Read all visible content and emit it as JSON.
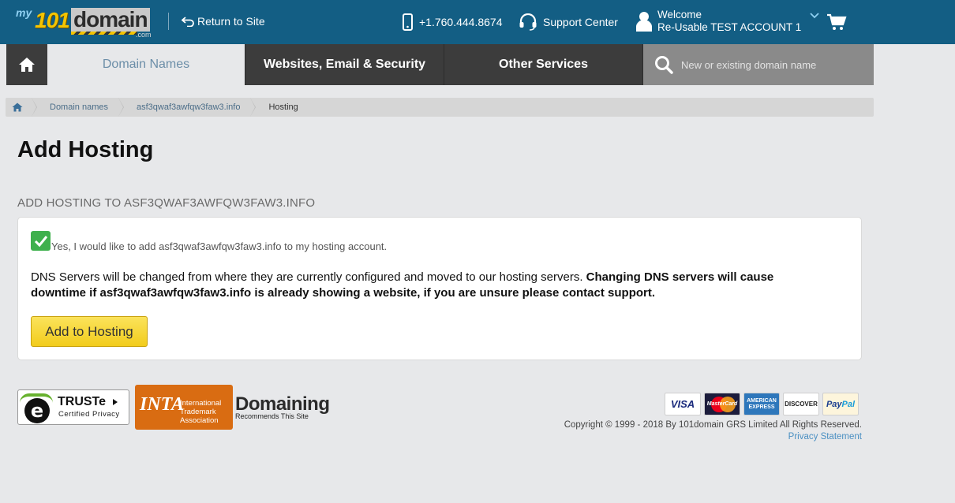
{
  "header": {
    "logo": {
      "my": "my",
      "num": "101",
      "word": "domain",
      "tld": ".com"
    },
    "return_label": "Return to Site",
    "phone": "+1.760.444.8674",
    "support_label": "Support Center",
    "welcome_label": "Welcome",
    "account_name": "Re-Usable TEST ACCOUNT 1",
    "icons": [
      "undo-icon",
      "phone-icon",
      "headset-icon",
      "user-icon",
      "chevron-down-icon",
      "cart-icon"
    ]
  },
  "nav": {
    "tabs": [
      {
        "label": "Domain Names",
        "active": true
      },
      {
        "label": "Websites, Email & Security",
        "active": false
      },
      {
        "label": "Other Services",
        "active": false
      }
    ],
    "search_placeholder": "New or existing domain name"
  },
  "breadcrumb": {
    "items": [
      "Domain names",
      "asf3qwaf3awfqw3faw3.info",
      "Hosting"
    ]
  },
  "page": {
    "title": "Add Hosting",
    "subheading": "ADD HOSTING TO ASF3QWAF3AWFQW3FAW3.INFO",
    "checkbox_label": "Yes, I would like to add asf3qwaf3awfqw3faw3.info to my hosting account.",
    "checkbox_checked": true,
    "dns_text": "DNS Servers will be changed from where they are currently configured and moved to our hosting servers.",
    "dns_warning": "Changing DNS servers will cause downtime if asf3qwaf3awfqw3faw3.info is already showing a website, if you are unsure please contact support.",
    "button_label": "Add to Hosting"
  },
  "footer": {
    "truste": {
      "title": "TRUSTe",
      "subtitle": "Certified Privacy"
    },
    "inta": {
      "big": "INTA",
      "small1": "International",
      "small2": "Trademark",
      "small3": "Association"
    },
    "domaining": {
      "word": "Domaining",
      "tag": "Recommends This Site"
    },
    "cards": {
      "visa": "VISA",
      "mastercard": "MasterCard",
      "amex1": "AMERICAN",
      "amex2": "EXPRESS",
      "discover": "DISCOVER",
      "paypal1": "Pay",
      "paypal2": "Pal"
    },
    "copyright": "Copyright © 1999 - 2018 By 101domain GRS Limited All Rights Reserved.",
    "privacy": "Privacy Statement"
  },
  "colors": {
    "topbar": "#135e84",
    "nav": "#3c3c3c",
    "accent_yellow": "#f2cc1c",
    "check_green": "#3fb04d",
    "link": "#4a8fc2"
  }
}
